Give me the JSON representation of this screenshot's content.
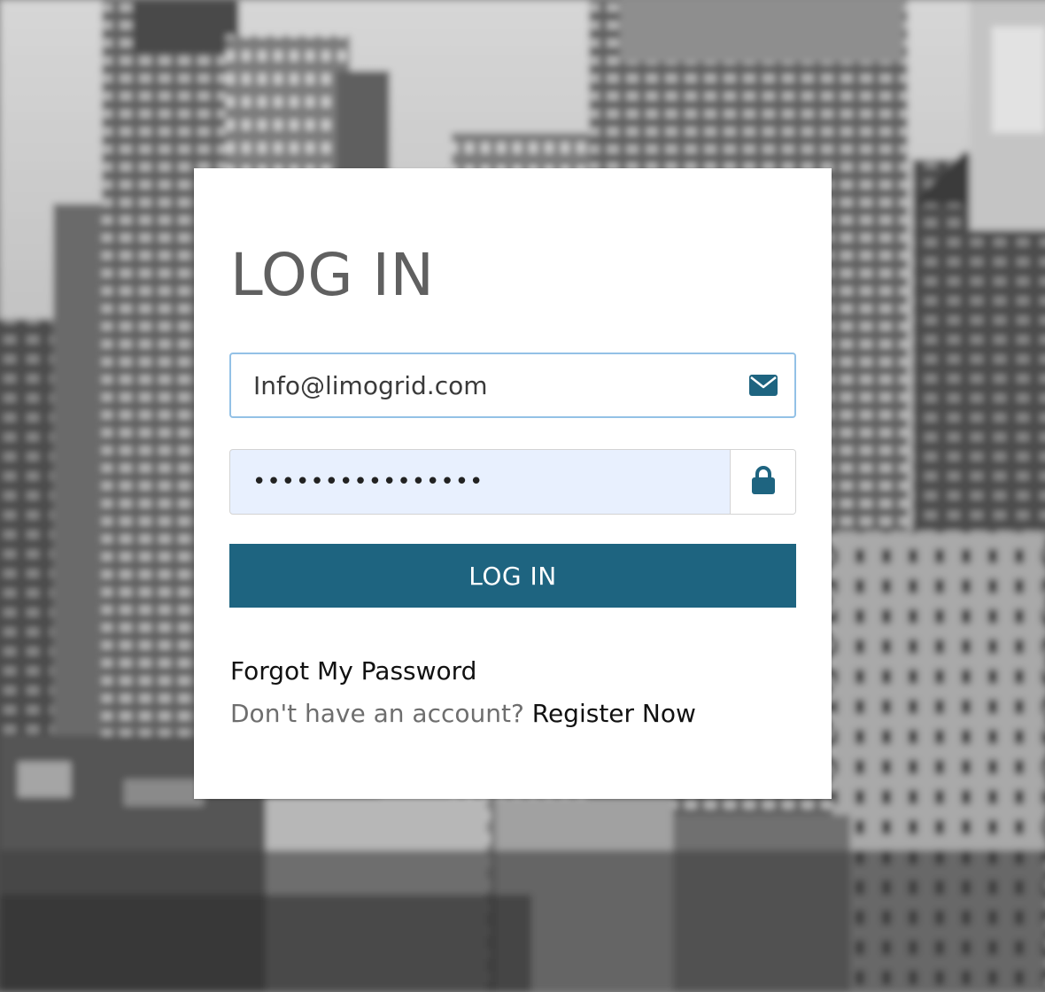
{
  "login": {
    "title": "LOG IN",
    "email_value": "Info@limogrid.com",
    "password_value": "••••••••••••••••",
    "submit_label": "LOG IN",
    "forgot_password_label": "Forgot My Password",
    "register_prompt": "Don't have an account?",
    "register_link_label": "Register Now"
  },
  "icons": {
    "email": "envelope-icon",
    "password": "lock-icon"
  },
  "colors": {
    "accent": "#1e6480",
    "email_focus_border": "#93c1e6",
    "password_fill": "#e8f0fe"
  }
}
